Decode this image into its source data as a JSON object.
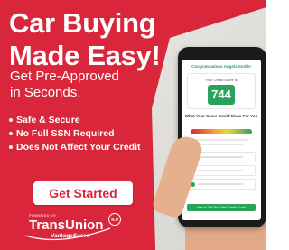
{
  "headline_line1": "Car Buying",
  "headline_line2": "Made Easy!",
  "sub_line1": "Get Pre-Approved",
  "sub_line2": "in Seconds.",
  "bullets": [
    "Safe & Secure",
    "No Full SSN Required",
    "Does Not Affect Your Credit"
  ],
  "cta_label": "Get Started",
  "brand": {
    "powered": "POWERED BY",
    "name": "TransUnion",
    "sub": "VantageScore",
    "badge": "4.0"
  },
  "phone": {
    "title": "Congratulations Angela Smith!",
    "score_label": "Your Credit Score is",
    "score": "744",
    "heading": "What Your Score Could Mean For You",
    "button": "How to Get Your Best Credit Score"
  },
  "colors": {
    "brand_red": "#d9263a",
    "score_green": "#27a35a"
  }
}
